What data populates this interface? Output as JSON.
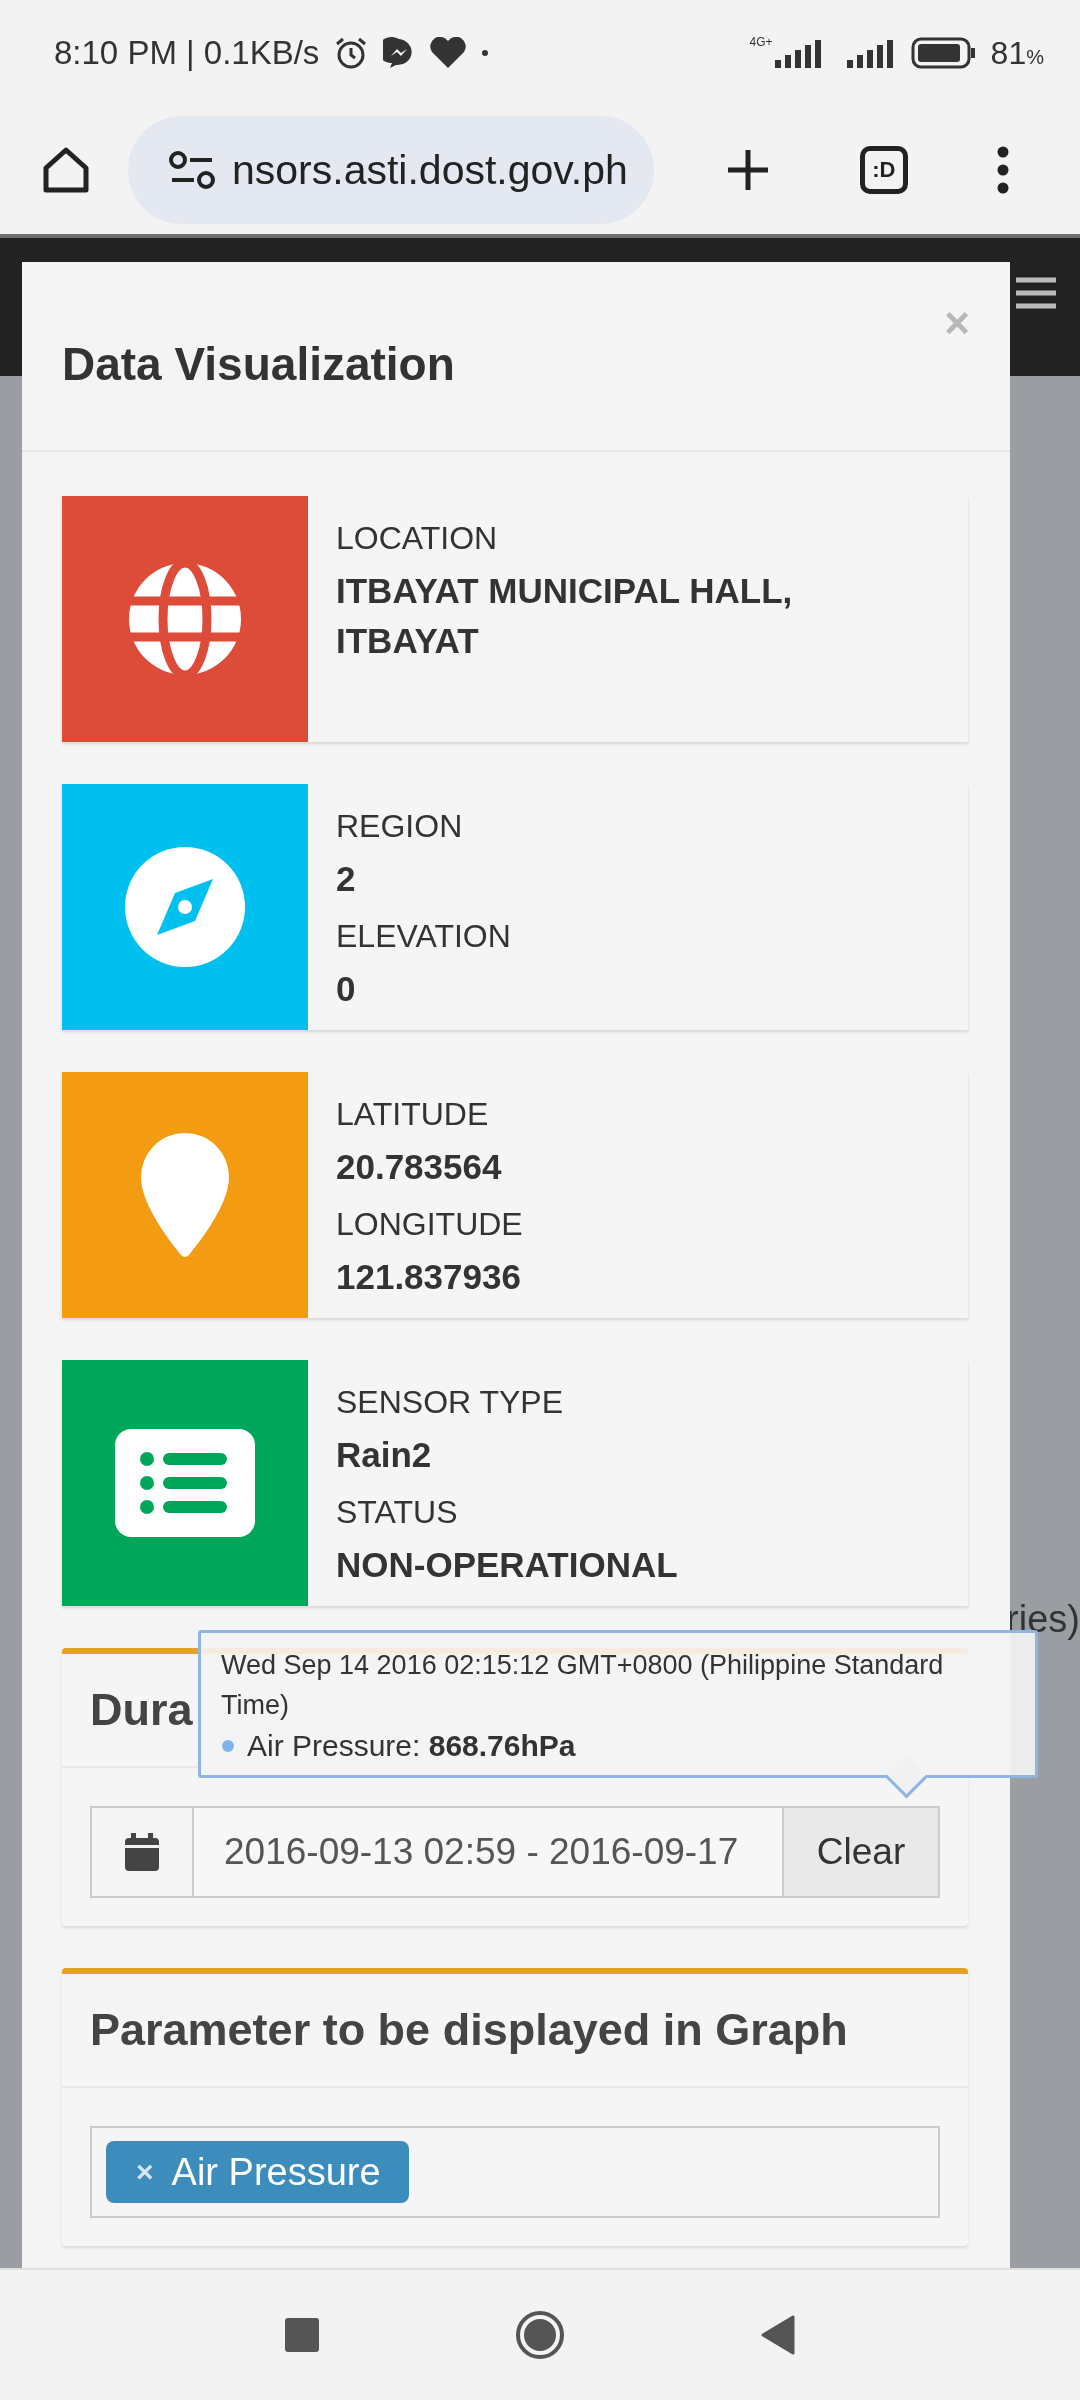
{
  "status_bar": {
    "time": "8:10 PM | 0.1KB/s",
    "network": "4G+",
    "battery": "81",
    "battery_unit": "%"
  },
  "browser": {
    "url": "nsors.asti.dost.gov.ph",
    "tab_switcher": ":D"
  },
  "background_page": {
    "text_fragment": "ries)"
  },
  "modal": {
    "title": "Data Visualization",
    "close": "×"
  },
  "info_cards": [
    {
      "kind": "globe",
      "color": "#dd4b39",
      "fields": [
        {
          "label": "LOCATION",
          "value": "ITBAYAT MUNICIPAL HALL, ITBAYAT"
        }
      ]
    },
    {
      "kind": "compass",
      "color": "#00c0ef",
      "fields": [
        {
          "label": "REGION",
          "value": "2"
        },
        {
          "label": "ELEVATION",
          "value": "0"
        }
      ]
    },
    {
      "kind": "pin",
      "color": "#f39c12",
      "fields": [
        {
          "label": "LATITUDE",
          "value": "20.783564"
        },
        {
          "label": "LONGITUDE",
          "value": "121.837936"
        }
      ]
    },
    {
      "kind": "list",
      "color": "#00a65a",
      "fields": [
        {
          "label": "SENSOR TYPE",
          "value": "Rain2"
        },
        {
          "label": "STATUS",
          "value": "NON-OPERATIONAL"
        }
      ]
    }
  ],
  "duration": {
    "title": "Dura",
    "range": "2016-09-13 02:59 - 2016-09-17",
    "clear": "Clear"
  },
  "tooltip": {
    "time": "Wed Sep 14 2016 02:15:12 GMT+0800 (Philippine Standard Time)",
    "point": "Air Pressure: **868.76hPa**"
  },
  "parameters": {
    "title": "Parameter to be displayed in Graph",
    "tags": [
      {
        "label": "Air Pressure",
        "remove": "×"
      }
    ]
  }
}
